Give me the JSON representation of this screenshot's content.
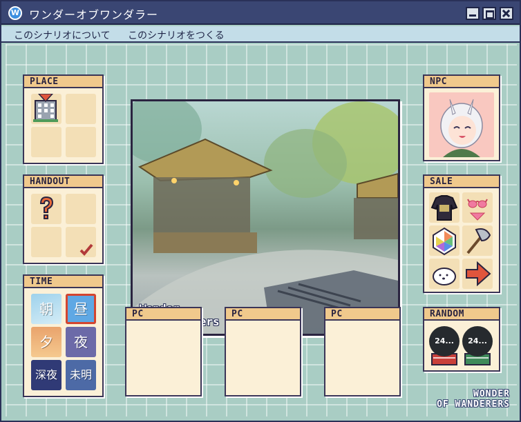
{
  "window": {
    "title": "ワンダーオブワンダラー",
    "icon_letter": "W"
  },
  "menu": {
    "items": [
      "このシナリオについて",
      "このシナリオをつくる"
    ]
  },
  "panels": {
    "place": "PLACE",
    "handout": "HANDOUT",
    "time": "TIME",
    "npc": "NPC",
    "sale": "SALE",
    "random": "RANDOM",
    "pc": [
      "PC",
      "PC",
      "PC"
    ]
  },
  "time": {
    "tiles": [
      "朝",
      "昼",
      "夕",
      "夜",
      "深夜",
      "未明"
    ],
    "selected": "昼"
  },
  "random": {
    "dice": [
      "24...",
      "24..."
    ]
  },
  "scene": {
    "caption_line1": "Wonder",
    "caption_line2": "of Wanderers"
  },
  "brand": {
    "line1": "WONDER",
    "line2": "OF WANDERERS"
  },
  "colors": {
    "titlebar": "#3a4673",
    "panel_head": "#f0c98c",
    "panel_body": "#fbf0d7",
    "grid_bg": "#a9cdc4"
  },
  "icons": {
    "place": "building-icon",
    "handout": "question-mark-icon",
    "sale": [
      "sweater-icon",
      "bikini-icon",
      "prism-card-icon",
      "battle-axe-icon",
      "white-dog-icon",
      "right-arrow-icon"
    ]
  }
}
